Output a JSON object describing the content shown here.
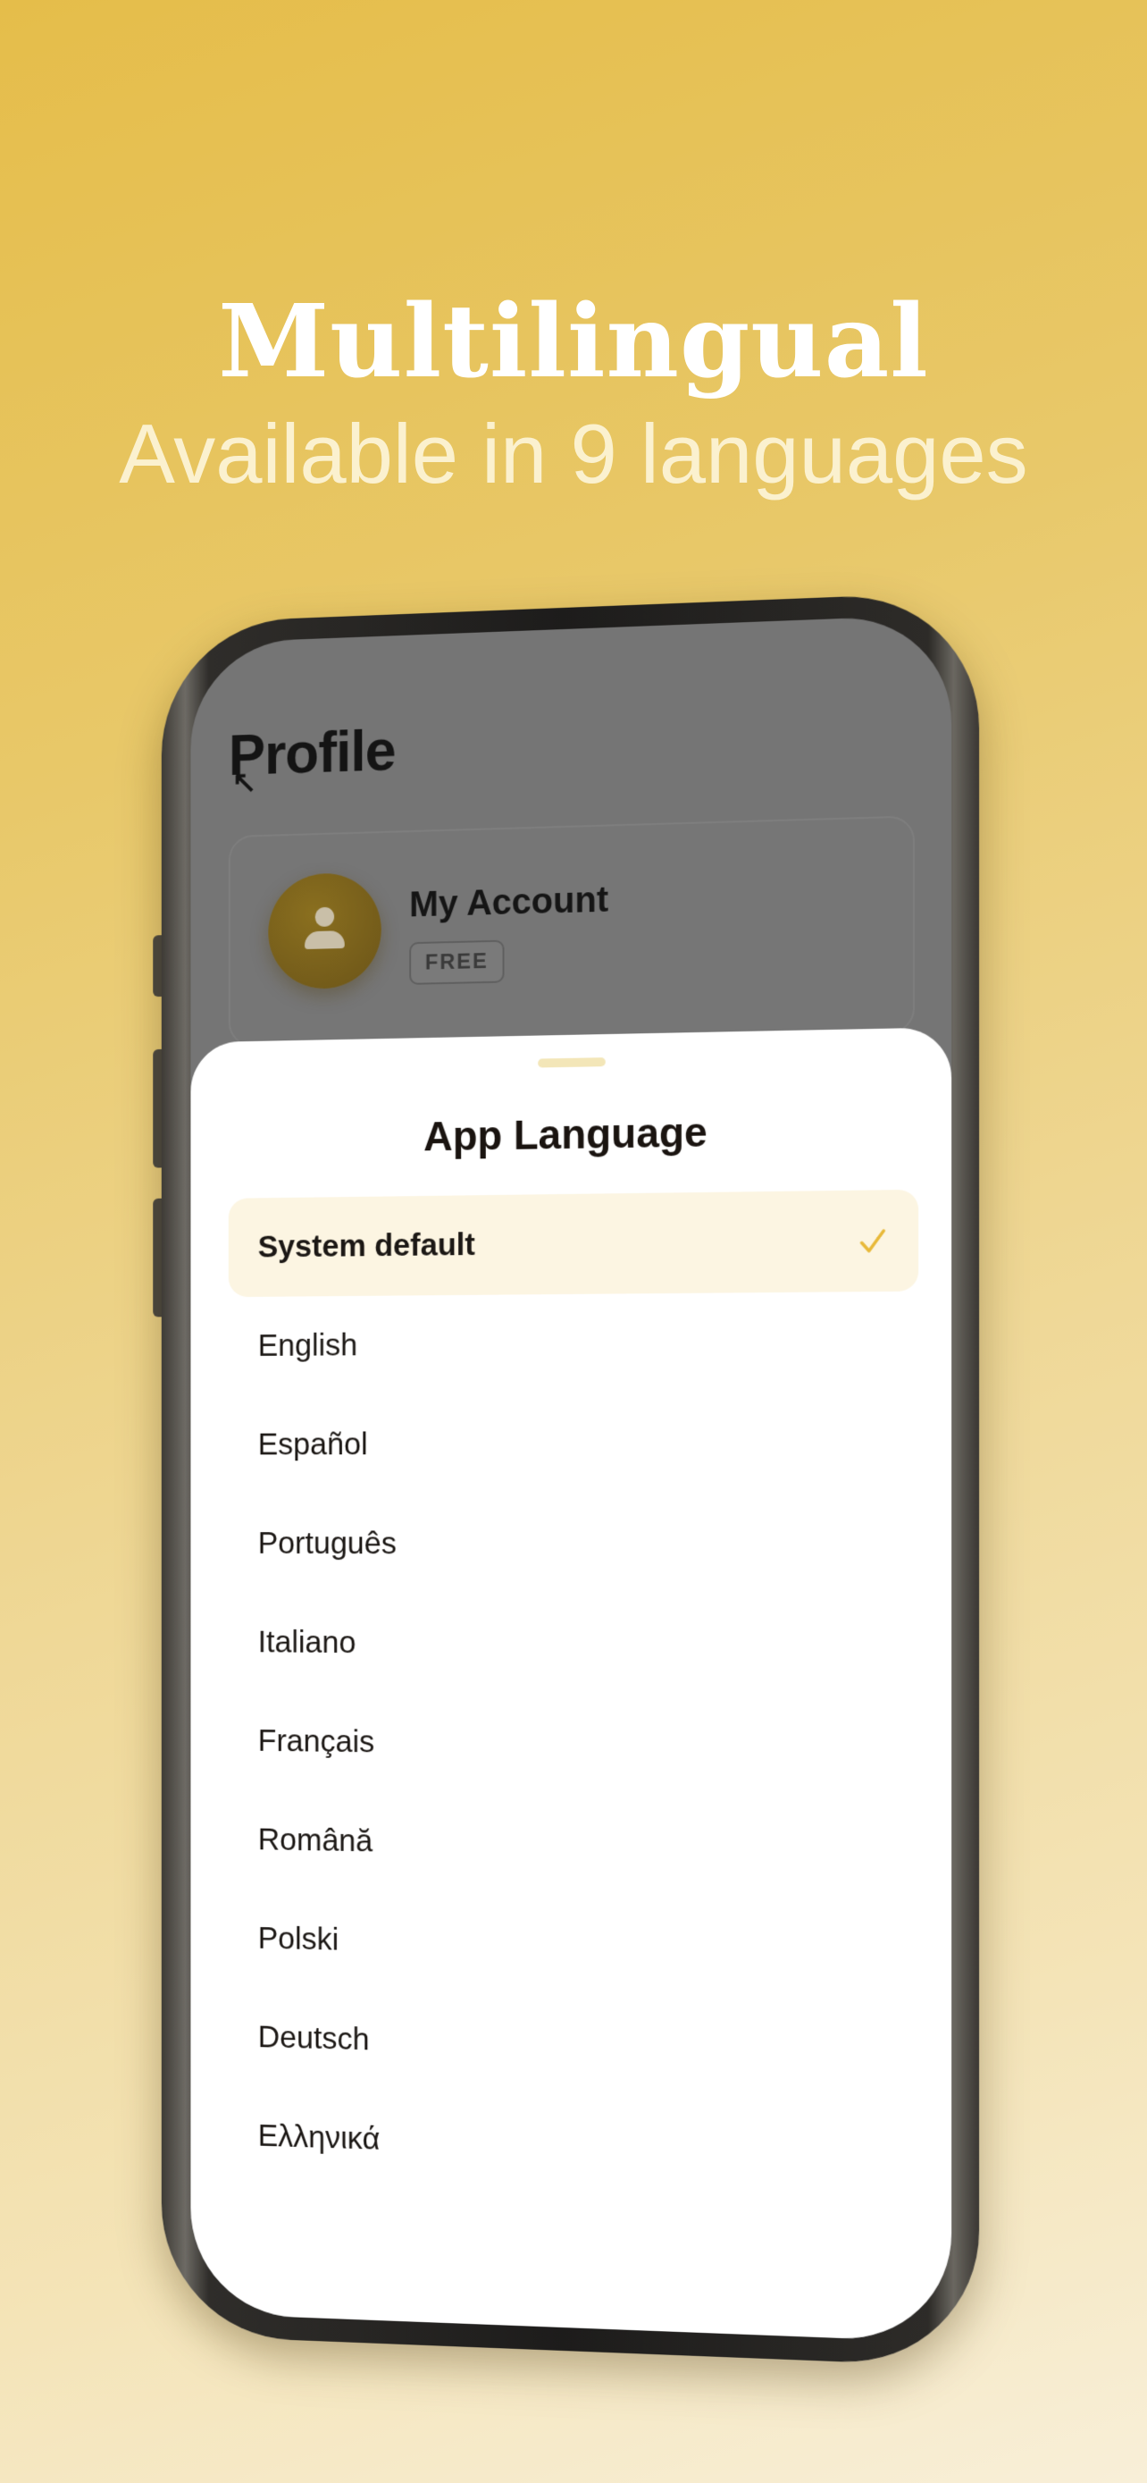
{
  "banner": {
    "headline": "Multilingual",
    "subheadline": "Available in 9 languages"
  },
  "profile": {
    "title": "Profile",
    "account_name": "My Account",
    "plan_badge": "FREE"
  },
  "language_sheet": {
    "title": "App Language",
    "selected_index": 0,
    "accent_color": "#e8b93a",
    "options": [
      {
        "label": "System default"
      },
      {
        "label": "English"
      },
      {
        "label": "Español"
      },
      {
        "label": "Português"
      },
      {
        "label": "Italiano"
      },
      {
        "label": "Français"
      },
      {
        "label": "Română"
      },
      {
        "label": "Polski"
      },
      {
        "label": "Deutsch"
      },
      {
        "label": "Ελληνικά"
      }
    ]
  }
}
